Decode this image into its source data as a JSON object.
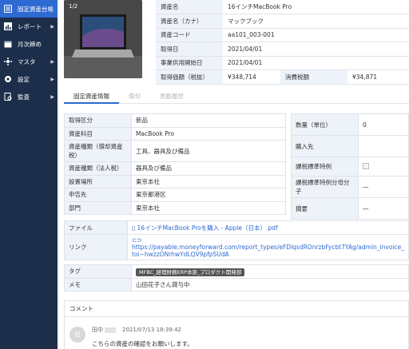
{
  "sidebar": {
    "items": [
      {
        "label": "固定資産台帳",
        "icon": "ledger-icon",
        "active": true
      },
      {
        "label": "レポート",
        "icon": "report-chart-icon",
        "arrow": "▶"
      },
      {
        "label": "月次締め",
        "icon": "calendar-icon"
      },
      {
        "label": "マスタ",
        "icon": "master-data-icon",
        "arrow": "▶"
      },
      {
        "label": "設定",
        "icon": "gear-icon",
        "arrow": "▶"
      },
      {
        "label": "監査",
        "icon": "audit-icon",
        "arrow": "▶"
      }
    ]
  },
  "photo": {
    "count": "1/2"
  },
  "asset_summary": {
    "rows": [
      {
        "label": "資産名",
        "value": "16インチMacBook Pro"
      },
      {
        "label": "資産名（カナ）",
        "value": "マックブック"
      },
      {
        "label": "資産コード",
        "value": "aa101_003-001"
      },
      {
        "label": "取得日",
        "value": "2021/04/01"
      },
      {
        "label": "事業供用開始日",
        "value": "2021/04/01"
      }
    ],
    "cost_label": "取得価額（税抜）",
    "cost_value": "¥348,714",
    "tax_label": "消費税額",
    "tax_value": "¥34,871"
  },
  "tabs": [
    {
      "label": "固定資産情報",
      "active": true
    },
    {
      "label": "償却"
    },
    {
      "label": "異動履歴"
    }
  ],
  "details_left": [
    {
      "label": "取得区分",
      "value": "新品"
    },
    {
      "label": "資産科目",
      "value": "MacBook Pro"
    },
    {
      "label": "資産種類（償却資産税）",
      "value": "工具、器具及び備品"
    },
    {
      "label": "資産種類（法人税）",
      "value": "器具及び備品"
    },
    {
      "label": "設置場所",
      "value": "東京本社"
    },
    {
      "label": "申告先",
      "value": "東京都港区"
    },
    {
      "label": "部門",
      "value": "東京本社"
    }
  ],
  "details_right": [
    {
      "label": "数量（単位）",
      "value": "0"
    },
    {
      "label": "購入先",
      "value": ""
    },
    {
      "label": "課税標準特例",
      "value": ""
    },
    {
      "label": "課税標準特例分母分子",
      "value": "—"
    },
    {
      "label": "摘要",
      "value": "—"
    }
  ],
  "file": {
    "label": "ファイル",
    "value": "16インチMacBook Proを購入 - Apple（日本）.pdf"
  },
  "link": {
    "label": "リンク",
    "line1": "https://payable.moneyforward.com/report_types/eFDlqsdROnrzbFycbt7YAg/admin_invoice_",
    "line2": "toi~hwzzONrhwYdLQV9pfpSUdA"
  },
  "tag": {
    "label": "タグ",
    "value": "MFBC_経理財務ERP本部_プロダクト開発部"
  },
  "memo": {
    "label": "メモ",
    "value": "山田花子さん貸与中"
  },
  "comments": {
    "title": "コメント",
    "author": "田中",
    "timestamp": "2021/07/13 18:39:42",
    "avatar_text": "田",
    "body": "こちらの資産の確認をお願いします。"
  }
}
